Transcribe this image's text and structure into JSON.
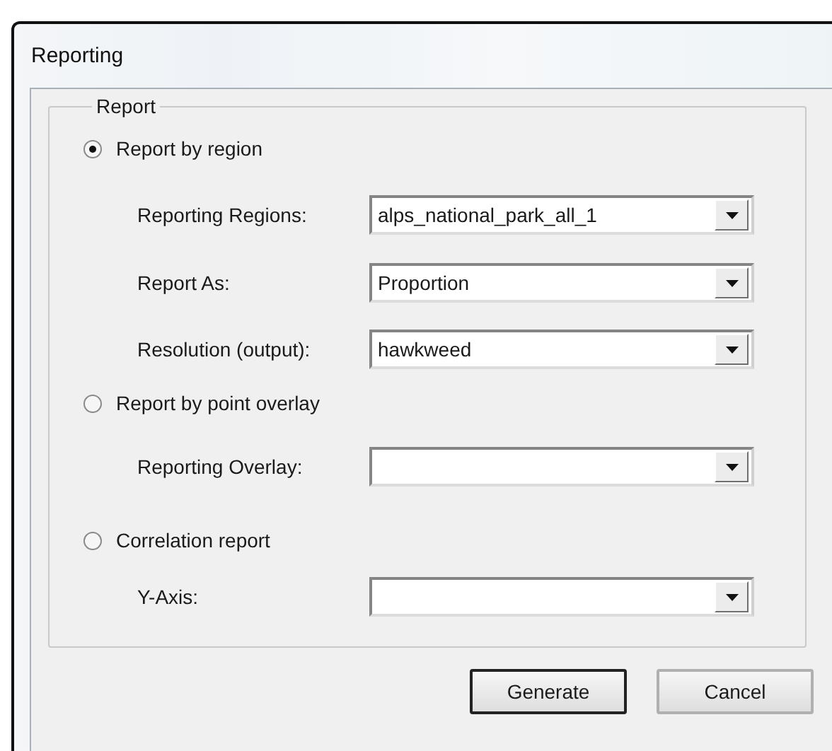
{
  "window": {
    "title": "Reporting"
  },
  "group": {
    "title": "Report"
  },
  "options": [
    {
      "label": "Report by region",
      "selected": true,
      "fields": [
        {
          "label": "Reporting Regions:",
          "value": "alps_national_park_all_1"
        },
        {
          "label": "Report As:",
          "value": "Proportion"
        },
        {
          "label": "Resolution (output):",
          "value": "hawkweed"
        }
      ]
    },
    {
      "label": "Report by point overlay",
      "selected": false,
      "fields": [
        {
          "label": "Reporting Overlay:"
        }
      ]
    },
    {
      "label": "Correlation report",
      "selected": false,
      "fields": [
        {
          "label": "Y-Axis:"
        }
      ]
    }
  ],
  "buttons": [
    {
      "label": "Generate",
      "default": true
    },
    {
      "label": "Cancel",
      "default": false
    }
  ]
}
